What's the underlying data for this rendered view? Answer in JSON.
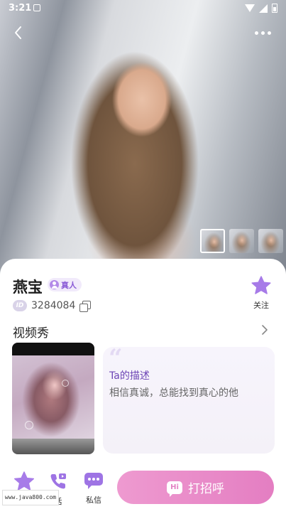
{
  "status_bar": {
    "time": "3:21"
  },
  "profile": {
    "name": "燕宝",
    "verified_label": "真人",
    "id_prefix": "ID",
    "id_number": "3284084",
    "follow_label": "关注"
  },
  "video_section": {
    "title": "视频秀",
    "description_title": "Ta的描述",
    "description_text": "相信真诚，总能找到真心的他"
  },
  "bottom_bar": {
    "call_label": "话",
    "message_label": "私信",
    "greet_label": "打招呼",
    "greet_icon_text": "Hi"
  },
  "watermark": "www.java800.com",
  "colors": {
    "accent_purple": "#8a5bd6",
    "cta_pink": "#e47ec2",
    "star_purple": "#a77be8"
  }
}
